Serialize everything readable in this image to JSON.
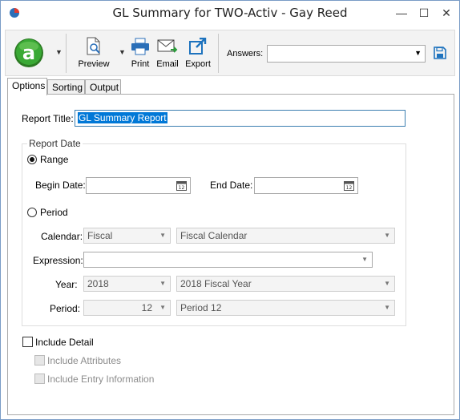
{
  "window": {
    "title": "GL Summary for TWO-Activ - Gay Reed",
    "minimize_glyph": "—",
    "maximize_glyph": "☐",
    "close_glyph": "✕"
  },
  "toolbar": {
    "preview_label": "Preview",
    "print_label": "Print",
    "email_label": "Email",
    "export_label": "Export",
    "answers_label": "Answers:",
    "answers_value": "",
    "dropdown_glyph": "▼"
  },
  "tabs": [
    {
      "label": "Options",
      "active": true
    },
    {
      "label": "Sorting",
      "active": false
    },
    {
      "label": "Output",
      "active": false
    }
  ],
  "options": {
    "report_title_label": "Report Title:",
    "report_title_value": "GL Summary Report",
    "report_date_legend": "Report Date",
    "range_label": "Range",
    "range_selected": true,
    "begin_date_label": "Begin Date:",
    "begin_date_value": "",
    "end_date_label": "End Date:",
    "end_date_value": "",
    "period_label": "Period",
    "period_selected": false,
    "calendar_label": "Calendar:",
    "calendar_value": "Fiscal",
    "calendar_name_value": "Fiscal Calendar",
    "expression_label": "Expression:",
    "expression_value": "",
    "year_label": "Year:",
    "year_value": "2018",
    "year_name_value": "2018 Fiscal Year",
    "period_field_label": "Period:",
    "period_value": "12",
    "period_name_value": "Period 12",
    "include_detail_label": "Include Detail",
    "include_detail_checked": false,
    "include_attributes_label": "Include Attributes",
    "include_entry_info_label": "Include Entry Information"
  },
  "colors": {
    "selection": "#0078d7",
    "focus_border": "#3c7fb1",
    "logo_green": "#3aa935",
    "save_blue": "#1e73be"
  }
}
